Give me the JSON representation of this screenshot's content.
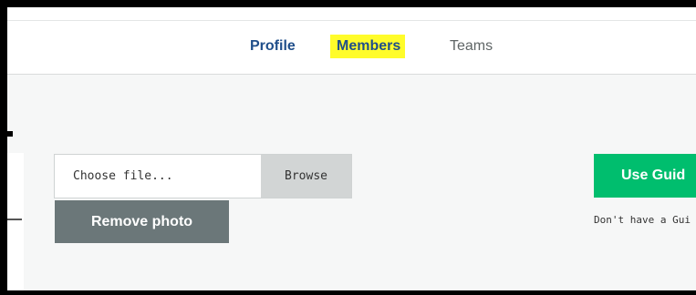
{
  "nav": {
    "tabs": [
      {
        "label": "Profile",
        "state": "active"
      },
      {
        "label": "Members",
        "state": "highlighted"
      },
      {
        "label": "Teams",
        "state": "inactive"
      }
    ],
    "highlight_color": "#fffc2a",
    "active_color": "#1f4e8a"
  },
  "photo": {
    "file_placeholder": "Choose file...",
    "browse_label": "Browse",
    "remove_label": "Remove photo"
  },
  "guide": {
    "button_label": "Use Guid",
    "note": "Don't have a Gui",
    "button_color": "#00be6e"
  }
}
